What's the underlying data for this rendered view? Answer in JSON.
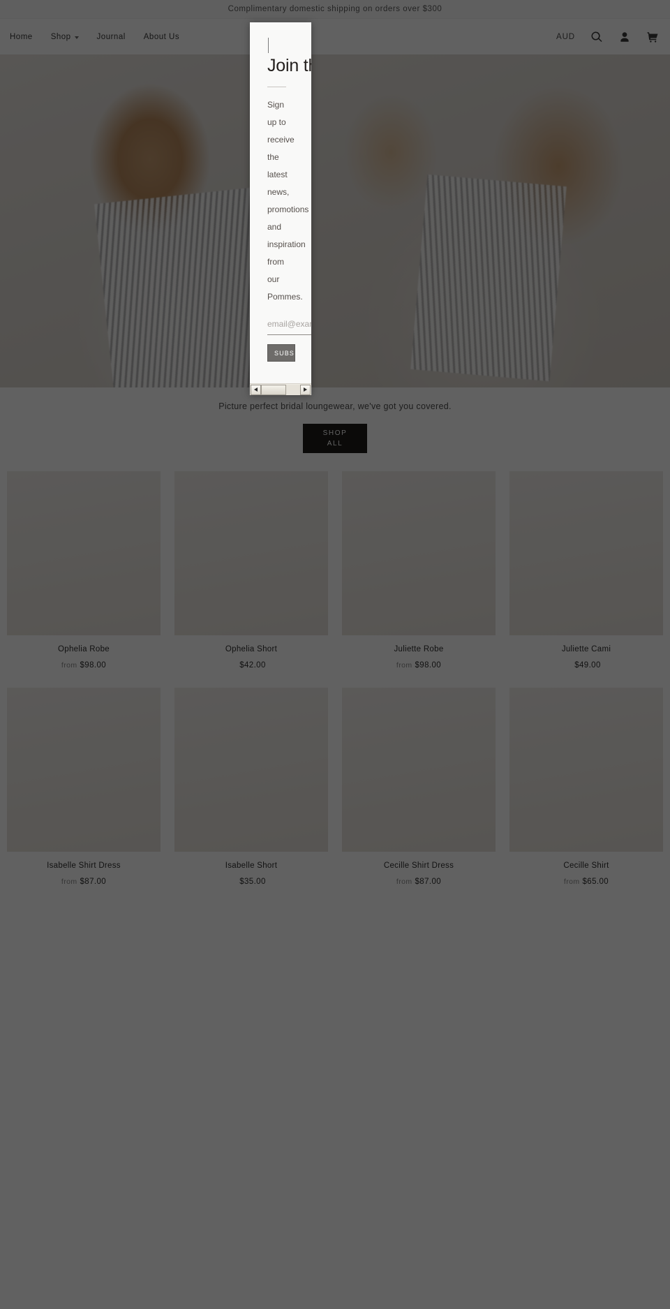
{
  "announcement": {
    "text": "Complimentary domestic shipping on orders over $300"
  },
  "header": {
    "nav": [
      {
        "label": "Home",
        "has_caret": false
      },
      {
        "label": "Shop",
        "has_caret": true
      },
      {
        "label": "Journal",
        "has_caret": false
      },
      {
        "label": "About Us",
        "has_caret": false
      }
    ],
    "currency": "AUD",
    "icons": [
      "search-icon",
      "account-icon",
      "cart-icon"
    ]
  },
  "hero": {
    "tagline": "Picture perfect bridal loungewear, we've got you covered.",
    "cta_line1": "SHOP",
    "cta_line2": "ALL"
  },
  "modal": {
    "title": "Join the Pomme Poste",
    "body": "Sign up to receive the latest news, promotions and inspiration from our Pommes.",
    "email_placeholder": "email@example.com",
    "submit_label": "SUBSCRIBE"
  },
  "products": [
    {
      "title": "Ophelia Robe",
      "from": "from",
      "price": "$98.00"
    },
    {
      "title": "Ophelia Short",
      "from": "",
      "price": "$42.00"
    },
    {
      "title": "Juliette Robe",
      "from": "from",
      "price": "$98.00"
    },
    {
      "title": "Juliette Cami",
      "from": "",
      "price": "$49.00"
    },
    {
      "title": "Isabelle Shirt Dress",
      "from": "from",
      "price": "$87.00"
    },
    {
      "title": "Isabelle Short",
      "from": "",
      "price": "$35.00"
    },
    {
      "title": "Cecille Shirt Dress",
      "from": "from",
      "price": "$87.00"
    },
    {
      "title": "Cecille Shirt",
      "from": "from",
      "price": "$65.00"
    }
  ],
  "colors": {
    "cta_bg": "#1d1b19",
    "modal_bg": "#f9f9f8",
    "overlay": "rgba(0,0,0,0.62)"
  }
}
